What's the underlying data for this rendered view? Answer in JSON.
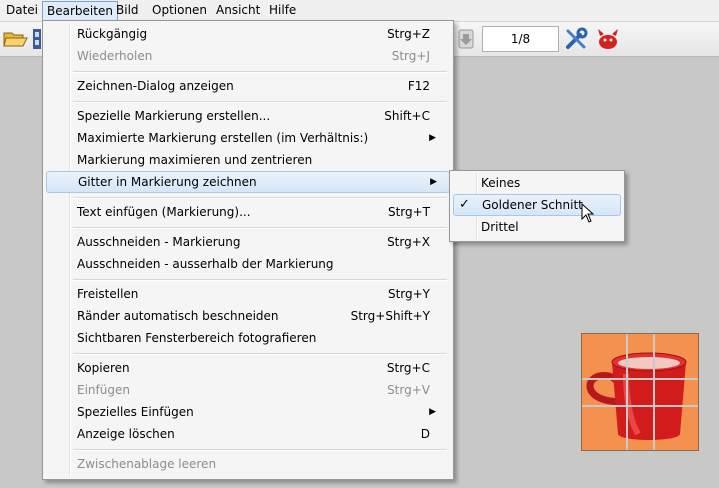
{
  "menubar": {
    "items": [
      "Datei",
      "Bearbeiten",
      "Bild",
      "Optionen",
      "Ansicht",
      "Hilfe"
    ],
    "active": "Bearbeiten"
  },
  "toolbar": {
    "page_indicator": "1/8",
    "icons": [
      "folder-open-icon",
      "filmstrip-icon",
      "down-arrow-icon",
      "tools-icon",
      "red-devil-icon"
    ]
  },
  "menu": {
    "items": [
      {
        "label": "Rückgängig",
        "shortcut": "Strg+Z"
      },
      {
        "label": "Wiederholen",
        "shortcut": "Strg+J",
        "disabled": true
      },
      {
        "label": "Zeichnen-Dialog anzeigen",
        "shortcut": "F12"
      },
      {
        "label": "Spezielle Markierung erstellen...",
        "shortcut": "Shift+C"
      },
      {
        "label": "Maximierte Markierung erstellen (im Verhältnis:)",
        "submenu": true
      },
      {
        "label": "Markierung maximieren und zentrieren"
      },
      {
        "label": "Gitter in Markierung zeichnen",
        "submenu": true,
        "highlighted": true
      },
      {
        "label": "Text einfügen (Markierung)...",
        "shortcut": "Strg+T"
      },
      {
        "label": "Ausschneiden - Markierung",
        "shortcut": "Strg+X"
      },
      {
        "label": "Ausschneiden - ausserhalb der Markierung"
      },
      {
        "label": "Freistellen",
        "shortcut": "Strg+Y"
      },
      {
        "label": "Ränder automatisch beschneiden",
        "shortcut": "Strg+Shift+Y"
      },
      {
        "label": "Sichtbaren Fensterbereich fotografieren"
      },
      {
        "label": "Kopieren",
        "shortcut": "Strg+C"
      },
      {
        "label": "Einfügen",
        "shortcut": "Strg+V",
        "disabled": true
      },
      {
        "label": "Spezielles Einfügen",
        "submenu": true
      },
      {
        "label": "Anzeige löschen",
        "shortcut": "D"
      },
      {
        "label": "Zwischenablage leeren",
        "disabled": true
      }
    ]
  },
  "submenu": {
    "items": [
      {
        "label": "Keines"
      },
      {
        "label": "Goldener Schnitt",
        "checked": true,
        "highlighted": true
      },
      {
        "label": "Drittel"
      }
    ]
  },
  "colors": {
    "highlight_border": "#a8c8ea",
    "thumbnail_bg": "#f4914f",
    "disabled_text": "#8d8d8d"
  }
}
